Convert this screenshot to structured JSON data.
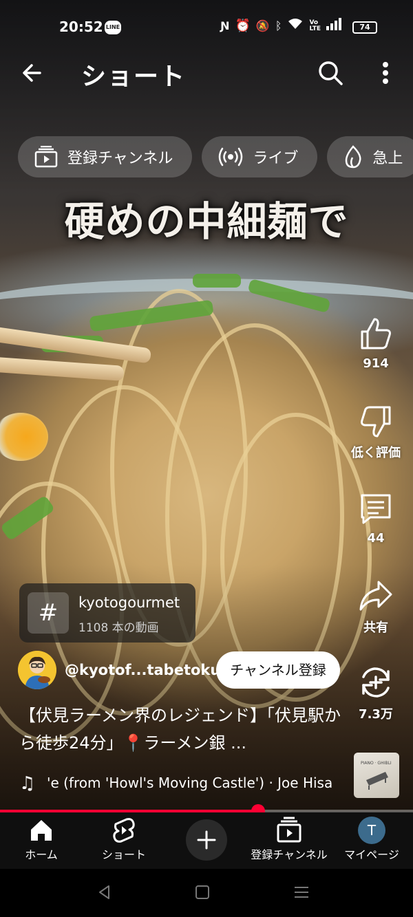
{
  "status_bar": {
    "time": "20:52",
    "line_badge": "LINE",
    "battery": "74"
  },
  "header": {
    "title": "ショート"
  },
  "chips": [
    {
      "label": "登録チャンネル",
      "icon": "subscriptions-icon"
    },
    {
      "label": "ライブ",
      "icon": "live-icon"
    },
    {
      "label": "急上",
      "icon": "trending-icon"
    }
  ],
  "video": {
    "overlay_caption": "硬めの中細麺で"
  },
  "actions": {
    "like_count": "914",
    "dislike_label": "低く評価",
    "comment_count": "44",
    "share_label": "共有",
    "remix_count": "7.3万"
  },
  "hashtag": {
    "tag": "kyotogourmet",
    "count_label": "1108 本の動画",
    "symbol": "#"
  },
  "channel": {
    "handle": "@kyotof...tabetoku",
    "subscribe_label": "チャンネル登録"
  },
  "description": "【伏見ラーメン界のレジェンド】「伏見駅から徒歩24分」📍ラーメン銀 ...",
  "music": {
    "track": "'e (from 'Howl's Moving Castle') · Joe Hisa"
  },
  "progress": {
    "fraction": 0.625
  },
  "bottom_nav": {
    "home": "ホーム",
    "shorts": "ショート",
    "subscriptions": "登録チャンネル",
    "you": "マイページ",
    "you_initial": "T"
  }
}
